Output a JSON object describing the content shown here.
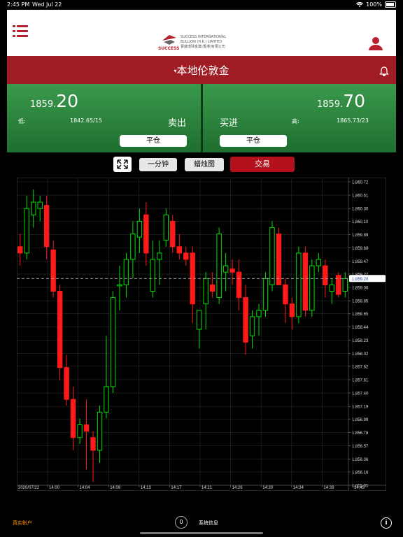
{
  "status": {
    "time": "2:45 PM",
    "date": "Wed Jul 22",
    "battery": "100%"
  },
  "header": {
    "logo_en_1": "SUCCESS INTERNATIONAL",
    "logo_en_2": "BULLION (H.K.) LIMITED",
    "logo_cn": "寰盛環球金業(香港)有限公司",
    "logo_word": "SUCCESS"
  },
  "title": "本地伦敦金",
  "sell": {
    "price_small": "1859.",
    "price_big": "20",
    "low_label": "低:",
    "range": "1842.65/15",
    "label": "卖出",
    "button": "平仓"
  },
  "buy": {
    "price_small": "1859.",
    "price_big": "70",
    "high_label": "高:",
    "range": "1865.73/23",
    "label": "买进",
    "button": "平仓"
  },
  "controls": {
    "interval": "一分钟",
    "chart_type": "蜡烛图",
    "trade": "交易"
  },
  "footer": {
    "account": "真实帐户",
    "count": "0",
    "message": "系统信息",
    "info": "i"
  },
  "colors": {
    "red": "#b3121c",
    "green_up": "#00e000",
    "down": "#ff1a1a"
  },
  "chart_data": {
    "type": "candlestick",
    "x_labels": [
      "2020/07/22",
      "14:00",
      "14:04",
      "14:08",
      "14:13",
      "14:17",
      "14:21",
      "14:26",
      "14:30",
      "14:34",
      "14:39",
      "14:43"
    ],
    "y_labels": [
      "1,860.72",
      "1,860.51",
      "1,860.30",
      "1,860.10",
      "1,859.89",
      "1,859.68",
      "1,859.47",
      "1,859.27",
      "1,859.06",
      "1,858.85",
      "1,858.65",
      "1,858.44",
      "1,858.23",
      "1,858.02",
      "1,857.82",
      "1,857.61",
      "1,857.40",
      "1,857.19",
      "1,856.99",
      "1,856.78",
      "1,856.57",
      "1,856.36",
      "1,856.16",
      "1,855.95"
    ],
    "ylim": [
      1855.95,
      1860.72
    ],
    "current_price": "1,859.20",
    "candles": [
      [
        1859.7,
        1859.9,
        1859.4,
        1859.6
      ],
      [
        1859.6,
        1860.5,
        1859.5,
        1860.3
      ],
      [
        1860.2,
        1860.6,
        1860.0,
        1860.4
      ],
      [
        1860.3,
        1860.5,
        1860.1,
        1860.4
      ],
      [
        1860.35,
        1860.5,
        1859.5,
        1859.7
      ],
      [
        1859.65,
        1859.8,
        1858.9,
        1859.0
      ],
      [
        1859.0,
        1859.1,
        1857.6,
        1857.8
      ],
      [
        1857.8,
        1858.0,
        1857.2,
        1857.3
      ],
      [
        1857.3,
        1857.5,
        1856.5,
        1856.7
      ],
      [
        1856.7,
        1857.0,
        1856.6,
        1856.9
      ],
      [
        1856.9,
        1857.3,
        1856.2,
        1856.8
      ],
      [
        1856.7,
        1856.8,
        1856.0,
        1856.5
      ],
      [
        1856.5,
        1857.2,
        1856.3,
        1857.1
      ],
      [
        1857.1,
        1858.3,
        1857.0,
        1857.5
      ],
      [
        1857.5,
        1859.0,
        1857.4,
        1858.9
      ],
      [
        1859.1,
        1859.4,
        1858.7,
        1859.1
      ],
      [
        1859.1,
        1859.6,
        1858.9,
        1859.5
      ],
      [
        1859.5,
        1860.1,
        1859.2,
        1859.9
      ],
      [
        1859.85,
        1860.3,
        1859.6,
        1860.1
      ],
      [
        1860.2,
        1860.4,
        1859.4,
        1859.6
      ],
      [
        1859.0,
        1859.8,
        1858.9,
        1859.5
      ],
      [
        1859.5,
        1859.8,
        1859.1,
        1859.6
      ],
      [
        1859.8,
        1860.3,
        1859.7,
        1860.2
      ],
      [
        1860.1,
        1860.2,
        1859.6,
        1859.7
      ],
      [
        1859.7,
        1859.9,
        1859.5,
        1859.6
      ],
      [
        1859.6,
        1859.7,
        1859.4,
        1859.5
      ],
      [
        1859.6,
        1859.7,
        1858.5,
        1858.8
      ],
      [
        1858.4,
        1858.7,
        1858.1,
        1858.7
      ],
      [
        1858.8,
        1859.3,
        1858.4,
        1859.2
      ],
      [
        1859.1,
        1859.3,
        1858.9,
        1859.0
      ],
      [
        1858.9,
        1860.0,
        1858.8,
        1859.9
      ],
      [
        1859.3,
        1859.6,
        1859.0,
        1859.4
      ],
      [
        1859.35,
        1859.5,
        1859.1,
        1859.3
      ],
      [
        1859.3,
        1859.5,
        1858.7,
        1858.9
      ],
      [
        1858.9,
        1859.1,
        1858.0,
        1858.2
      ],
      [
        1858.3,
        1858.7,
        1858.1,
        1858.6
      ],
      [
        1858.6,
        1858.8,
        1858.3,
        1858.7
      ],
      [
        1858.7,
        1859.3,
        1858.6,
        1859.2
      ],
      [
        1859.1,
        1860.1,
        1859.0,
        1860.0
      ],
      [
        1859.9,
        1860.0,
        1859.1,
        1859.1
      ],
      [
        1859.1,
        1859.2,
        1858.5,
        1858.8
      ],
      [
        1858.8,
        1858.9,
        1858.4,
        1858.6
      ],
      [
        1858.6,
        1859.7,
        1858.5,
        1859.6
      ],
      [
        1859.6,
        1859.7,
        1858.6,
        1858.7
      ],
      [
        1858.7,
        1859.5,
        1858.6,
        1859.4
      ],
      [
        1859.4,
        1859.6,
        1859.3,
        1859.5
      ],
      [
        1859.4,
        1859.5,
        1858.9,
        1859.1
      ],
      [
        1859.0,
        1859.2,
        1858.8,
        1859.1
      ],
      [
        1859.25,
        1859.3,
        1858.9,
        1858.95
      ],
      [
        1859.0,
        1859.3,
        1858.9,
        1859.2
      ]
    ]
  }
}
